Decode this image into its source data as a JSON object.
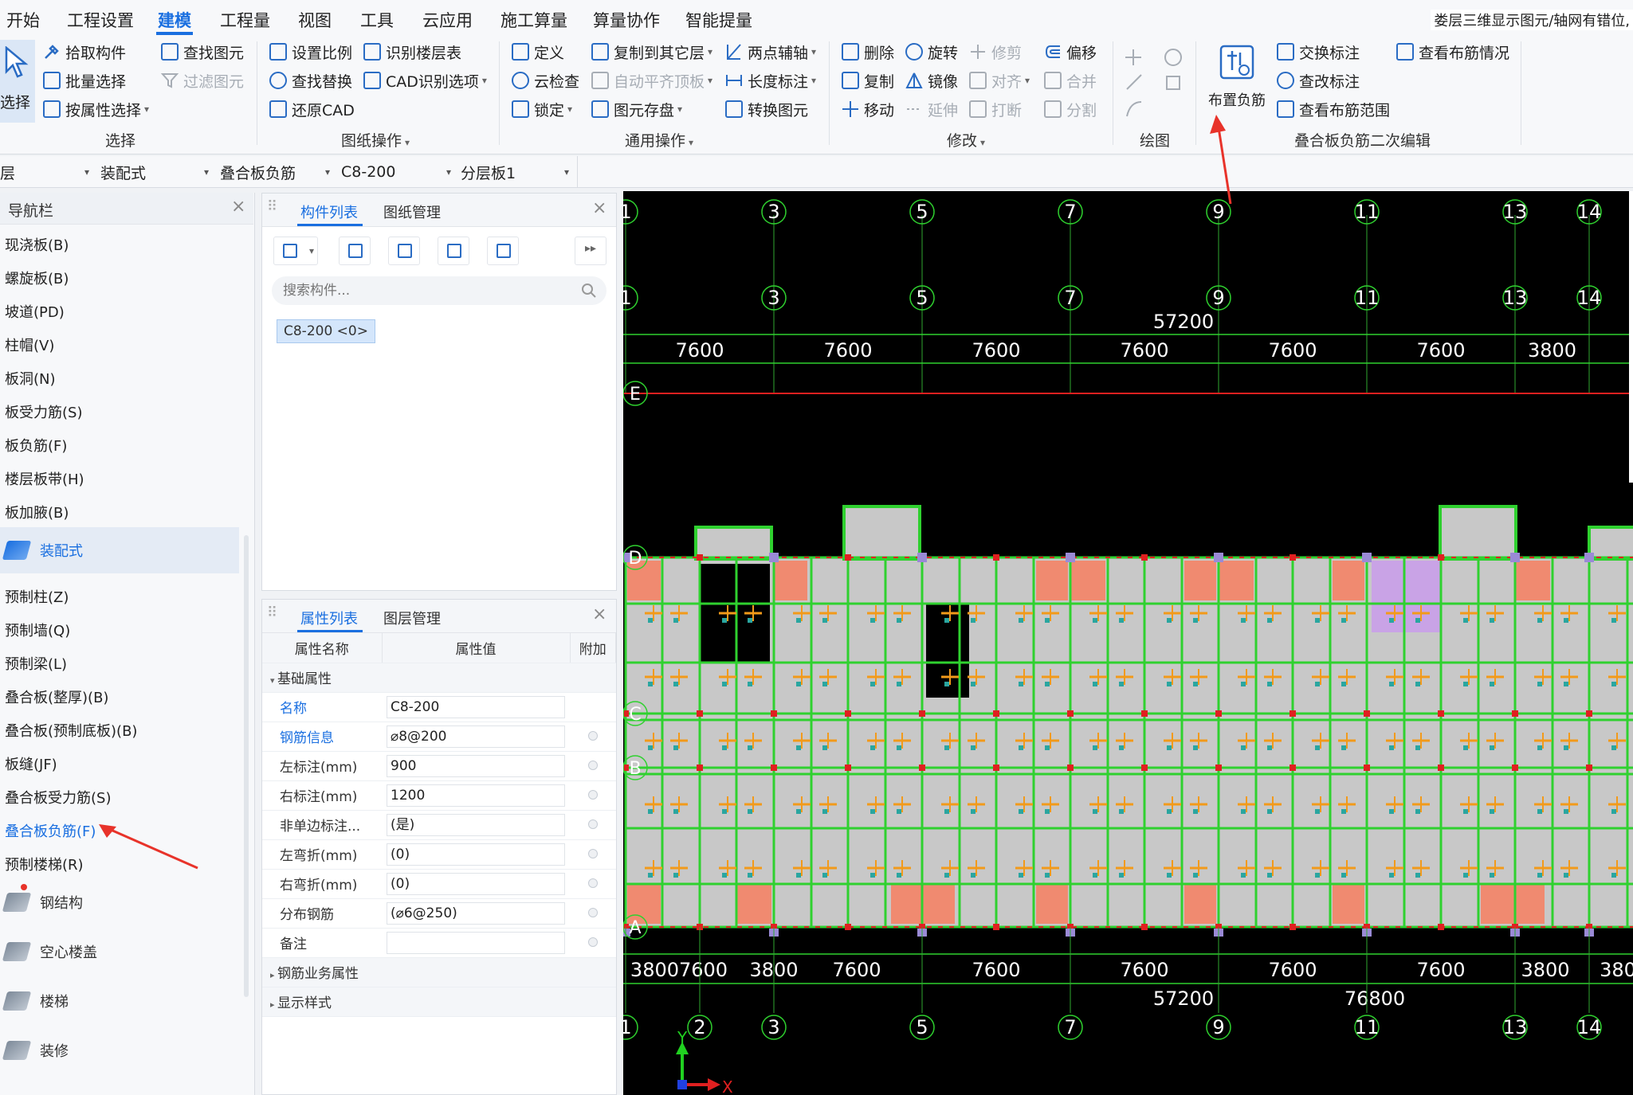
{
  "menu": [
    "开始",
    "工程设置",
    "建模",
    "工程量",
    "视图",
    "工具",
    "云应用",
    "施工算量",
    "算量协作",
    "智能提量"
  ],
  "menu_active": "建模",
  "notice": "娄层三维显示图元/轴网有错位,",
  "ribbon": {
    "select": {
      "big": "选择",
      "b1": "拾取构件",
      "b2": "批量选择",
      "b3": "按属性选择",
      "b4": "查找图元",
      "b5": "过滤图元",
      "label": "选择"
    },
    "drawing": {
      "b1": "设置比例",
      "b2": "识别楼层表",
      "b3": "查找替换",
      "b4": "CAD识别选项",
      "b5": "还原CAD",
      "label": "图纸操作"
    },
    "common": {
      "b1": "定义",
      "b2": "复制到其它层",
      "b3": "两点辅轴",
      "b4": "云检查",
      "b5": "自动平齐顶板",
      "b6": "长度标注",
      "b7": "锁定",
      "b8": "图元存盘",
      "b9": "转换图元",
      "label": "通用操作"
    },
    "modify": {
      "b1": "删除",
      "b2": "旋转",
      "b3": "修剪",
      "b4": "偏移",
      "b5": "复制",
      "b6": "镜像",
      "b7": "对齐",
      "b8": "合并",
      "b9": "移动",
      "b10": "延伸",
      "b11": "打断",
      "b12": "分割",
      "label": "修改"
    },
    "draw": {
      "label": "绘图"
    },
    "edit2": {
      "big": "布置负筋",
      "b1": "交换标注",
      "b2": "查看布筋情况",
      "b3": "查改标注",
      "b4": "查看布筋范围",
      "label": "叠合板负筋二次编辑"
    }
  },
  "combos": [
    "层",
    "装配式",
    "叠合板负筋",
    "C8-200",
    "分层板1"
  ],
  "nav": {
    "title": "导航栏",
    "items_top": [
      "现浇板(B)",
      "螺旋板(B)",
      "坡道(PD)",
      "柱帽(V)",
      "板洞(N)",
      "板受力筋(S)",
      "板负筋(F)",
      "楼层板带(H)",
      "板加腋(B)"
    ],
    "group_prefab": "装配式",
    "items_prefab": [
      "预制柱(Z)",
      "预制墙(Q)",
      "预制梁(L)",
      "叠合板(整厚)(B)",
      "叠合板(预制底板)(B)",
      "板缝(JF)",
      "叠合板受力筋(S)",
      "叠合板负筋(F)",
      "预制楼梯(R)"
    ],
    "active_item": "叠合板负筋(F)",
    "groups_bottom": [
      "钢结构",
      "空心楼盖",
      "楼梯",
      "装修"
    ]
  },
  "complist": {
    "tab1": "构件列表",
    "tab2": "图纸管理",
    "search_placeholder": "搜索构件...",
    "chip": "C8-200 <0>"
  },
  "props": {
    "tab1": "属性列表",
    "tab2": "图层管理",
    "headers": [
      "属性名称",
      "属性值",
      "附加"
    ],
    "section_basic": "基础属性",
    "rows": [
      {
        "name": "名称",
        "value": "C8-200"
      },
      {
        "name": "钢筋信息",
        "value": "⌀8@200"
      },
      {
        "name": "左标注(mm)",
        "value": "900"
      },
      {
        "name": "右标注(mm)",
        "value": "1200"
      },
      {
        "name": "非单边标注...",
        "value": "(是)"
      },
      {
        "name": "左弯折(mm)",
        "value": "(0)"
      },
      {
        "name": "右弯折(mm)",
        "value": "(0)"
      },
      {
        "name": "分布钢筋",
        "value": "(⌀6@250)"
      },
      {
        "name": "备注",
        "value": ""
      }
    ],
    "section_rebar": "钢筋业务属性",
    "section_display": "显示样式"
  },
  "canvas": {
    "axes_top": [
      "1",
      "3",
      "5",
      "7",
      "9",
      "11",
      "13",
      "14"
    ],
    "axes_bottom": [
      "1",
      "2",
      "3",
      "5",
      "7",
      "9",
      "11",
      "13",
      "14"
    ],
    "rows_axes": [
      "E",
      "D",
      "C",
      "B",
      "A"
    ],
    "top_total": "57200",
    "top_dims": [
      "7600",
      "7600",
      "7600",
      "7600",
      "7600",
      "7600",
      "3800"
    ],
    "bottom_dims": [
      "38007600",
      "3800",
      "7600",
      "7600",
      "7600",
      "7600",
      "7600",
      "3800",
      "380"
    ],
    "bottom_total1": "57200",
    "bottom_total2": "76800",
    "y_label": "Y",
    "x_label": "X"
  },
  "colors": {
    "accent": "#1a6fe0",
    "arrow": "#e8332a",
    "grid": "#2fd12f",
    "slab": "#c8c8c8",
    "salmon": "#f08a70",
    "purple": "#c9a3e6"
  }
}
